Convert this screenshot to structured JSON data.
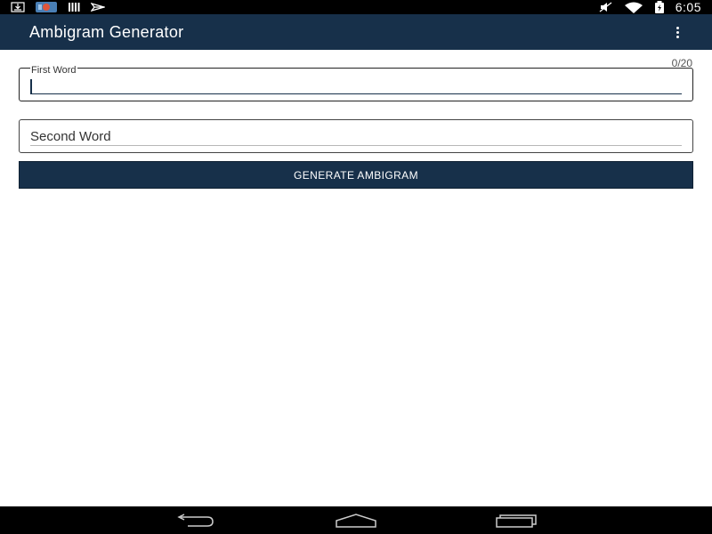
{
  "status_bar": {
    "time": "6:05",
    "icons_left": [
      "download-icon",
      "app-notification-icon",
      "storage-icon",
      "flight-icon"
    ],
    "icons_right": [
      "mute-icon",
      "wifi-icon",
      "battery-icon"
    ]
  },
  "app_bar": {
    "title": "Ambigram Generator",
    "menu_icon": "more-vert-icon"
  },
  "form": {
    "first_word": {
      "label": "First Word",
      "value": "",
      "counter": "0/20"
    },
    "second_word": {
      "label": "Second Word",
      "value": ""
    },
    "generate_label": "GENERATE AMBIGRAM"
  },
  "nav_bar": {
    "buttons": [
      "back-icon",
      "home-icon",
      "recents-icon"
    ]
  },
  "colors": {
    "primary": "#17304a",
    "status_bar": "#000000",
    "background": "#ffffff"
  }
}
